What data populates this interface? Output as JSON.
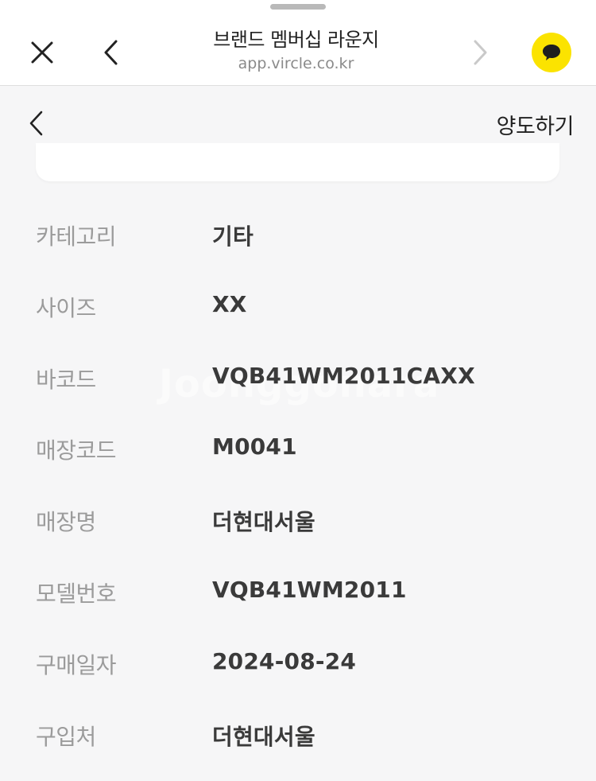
{
  "browser": {
    "title": "브랜드 멤버십 라운지",
    "url": "app.vircle.co.kr",
    "chat_color": "#fbe300"
  },
  "page": {
    "transfer_label": "양도하기"
  },
  "details": [
    {
      "label": "카테고리",
      "value": "기타"
    },
    {
      "label": "사이즈",
      "value": "XX"
    },
    {
      "label": "바코드",
      "value": "VQB41WM2011CAXX"
    },
    {
      "label": "매장코드",
      "value": "M0041"
    },
    {
      "label": "매장명",
      "value": "더현대서울"
    },
    {
      "label": "모델번호",
      "value": "VQB41WM2011"
    },
    {
      "label": "구매일자",
      "value": "2024-08-24"
    },
    {
      "label": "구입처",
      "value": "더현대서울"
    }
  ],
  "watermark": "Joonggonara"
}
